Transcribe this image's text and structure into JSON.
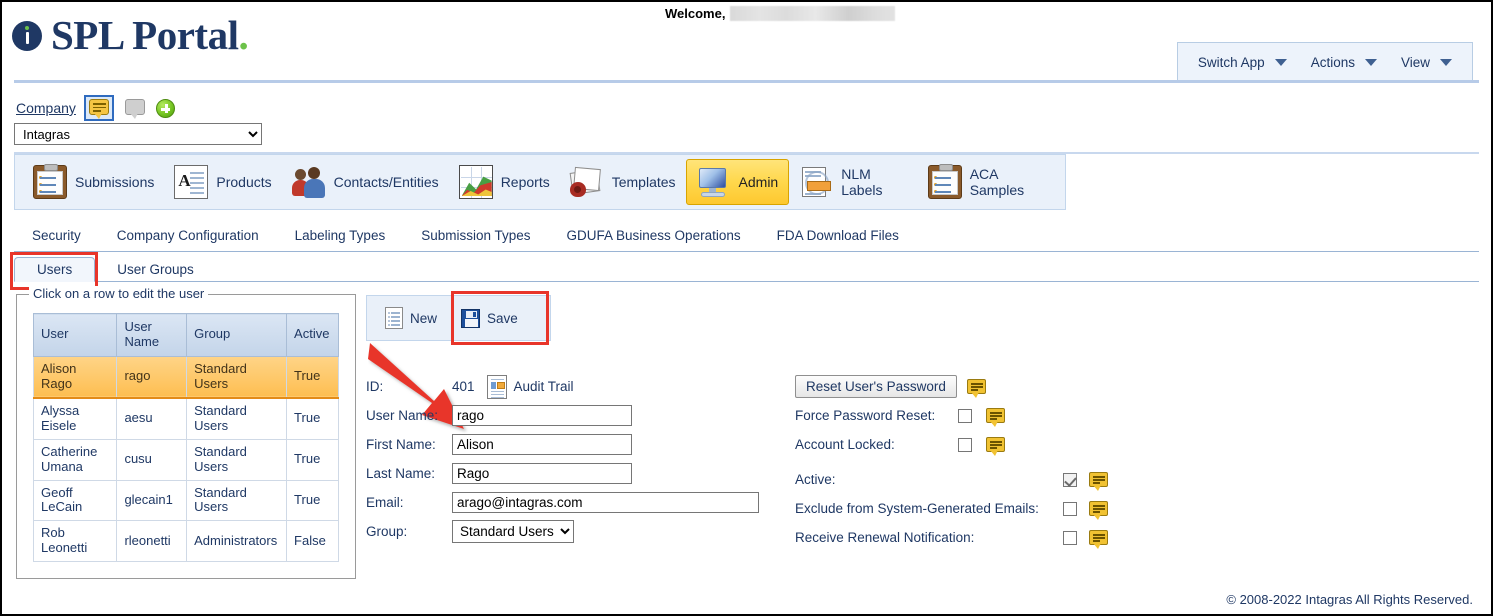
{
  "header": {
    "welcome_label": "Welcome,",
    "welcome_user_redacted": "",
    "logo_text": "SPL Portal",
    "logo_dot": ".",
    "app_toolbar": [
      {
        "label": "Switch App"
      },
      {
        "label": "Actions"
      },
      {
        "label": "View"
      }
    ]
  },
  "company": {
    "link_label": "Company",
    "selected": "Intagras",
    "options": [
      "Intagras"
    ],
    "note_icon": "speech-bubble-icon",
    "note_gray_icon": "speech-bubble-gray-icon",
    "add_icon": "add-circle-icon"
  },
  "modules": [
    {
      "label": "Submissions",
      "icon": "clipboard-icon",
      "active": false
    },
    {
      "label": "Products",
      "icon": "document-a-icon",
      "active": false
    },
    {
      "label": "Contacts/Entities",
      "icon": "people-icon",
      "active": false
    },
    {
      "label": "Reports",
      "icon": "chart-icon",
      "active": false
    },
    {
      "label": "Templates",
      "icon": "templates-icon",
      "active": false
    },
    {
      "label": "Admin",
      "icon": "monitor-icon",
      "active": true
    },
    {
      "label": "NLM Labels",
      "icon": "label-page-icon",
      "active": false
    },
    {
      "label": "ACA Samples",
      "icon": "clipboard-icon",
      "active": false
    }
  ],
  "admin_tabs": [
    {
      "label": "Security",
      "active": false
    },
    {
      "label": "Company Configuration",
      "active": false
    },
    {
      "label": "Labeling Types",
      "active": false
    },
    {
      "label": "Submission Types",
      "active": false
    },
    {
      "label": "GDUFA Business Operations",
      "active": false
    },
    {
      "label": "FDA Download Files",
      "active": false
    }
  ],
  "security_subtabs": [
    {
      "label": "Users",
      "active": true
    },
    {
      "label": "User Groups",
      "active": false
    }
  ],
  "user_grid": {
    "legend": "Click on a row to edit the user",
    "columns": [
      "User",
      "User Name",
      "Group",
      "Active"
    ],
    "rows": [
      {
        "user": "Alison Rago",
        "username": "rago",
        "group": "Standard Users",
        "active": "True",
        "selected": true
      },
      {
        "user": "Alyssa Eisele",
        "username": "aesu",
        "group": "Standard Users",
        "active": "True",
        "selected": false
      },
      {
        "user": "Catherine Umana",
        "username": "cusu",
        "group": "Standard Users",
        "active": "True",
        "selected": false
      },
      {
        "user": "Geoff LeCain",
        "username": "glecain1",
        "group": "Standard Users",
        "active": "True",
        "selected": false
      },
      {
        "user": "Rob Leonetti",
        "username": "rleonetti",
        "group": "Administrators",
        "active": "False",
        "selected": false
      }
    ]
  },
  "commands": {
    "new_label": "New",
    "save_label": "Save"
  },
  "user_form": {
    "id_label": "ID:",
    "id_value": "401",
    "audit_trail_label": "Audit Trail",
    "username_label": "User Name:",
    "username_value": "rago",
    "firstname_label": "First Name:",
    "firstname_value": "Alison",
    "lastname_label": "Last Name:",
    "lastname_value": "Rago",
    "email_label": "Email:",
    "email_value": "arago@intagras.com",
    "group_label": "Group:",
    "group_value": "Standard Users",
    "group_options": [
      "Standard Users",
      "Administrators"
    ]
  },
  "user_options": {
    "reset_password_label": "Reset User's Password",
    "force_password_reset_label": "Force Password Reset:",
    "force_password_reset_checked": false,
    "account_locked_label": "Account Locked:",
    "account_locked_checked": false,
    "active_label": "Active:",
    "active_checked": true,
    "exclude_emails_label": "Exclude from System-Generated Emails:",
    "exclude_emails_checked": false,
    "receive_renewal_label": "Receive Renewal Notification:",
    "receive_renewal_checked": false
  },
  "footer": {
    "copyright": "© 2008-2022 Intagras All Rights Reserved."
  },
  "annotations": {
    "color": "#e8352a",
    "users_tab_box": "red-rectangle-users-tab",
    "save_button_box": "red-rectangle-save-button",
    "arrow_to_username": "red-arrow-to-username-field"
  }
}
